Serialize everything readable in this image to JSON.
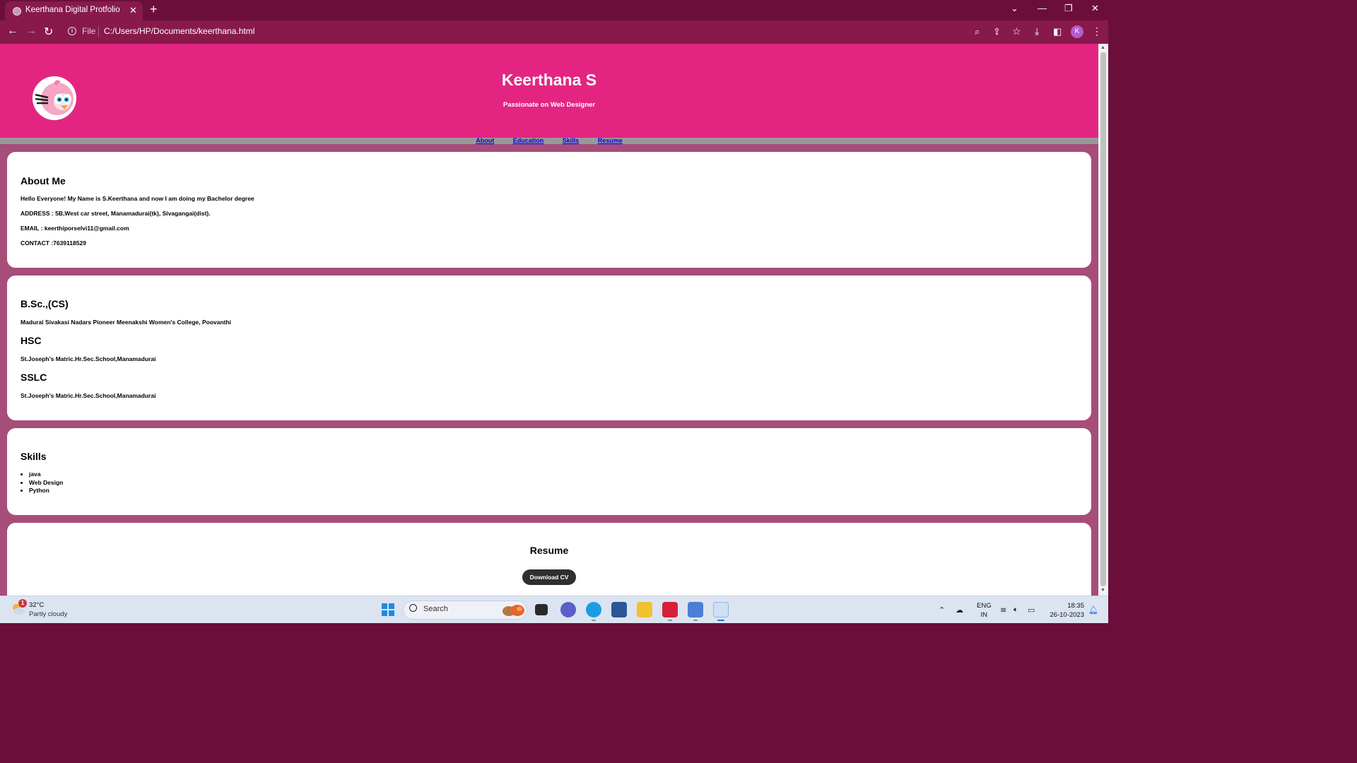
{
  "browser": {
    "tab_title": "Keerthana Digital Protfolio",
    "url_scheme": "File",
    "url": "C:/Users/HP/Documents/keerthana.html",
    "profile_initial": "K"
  },
  "site": {
    "name": "Keerthana S",
    "tagline": "Passionate on Web Designer"
  },
  "nav": {
    "about": "About",
    "education": "Education",
    "skills": "Skills",
    "resume": "Resume"
  },
  "about": {
    "heading": "About Me",
    "intro": "Hello Everyone! My Name is S.Keerthana and now I am doing my Bachelor degree",
    "address": "ADDRESS : 5B,West car street, Manamadurai(tk), Sivagangai(dist).",
    "email": "EMAIL : keerthiporselvi11@gmail.com",
    "contact": "CONTACT :7639118529"
  },
  "education": {
    "degree": "B.Sc.,(CS)",
    "degree_school": "Madurai Sivakasi Nadars Pioneer Meenakshi Women's College, Poovanthi",
    "hsc": "HSC",
    "hsc_school": "St.Joseph's Matric.Hr.Sec.School,Manamadurai",
    "sslc": "SSLC",
    "sslc_school": "St.Joseph's Matric.Hr.Sec.School,Manamadurai"
  },
  "skills": {
    "heading": "Skills",
    "items": [
      "java",
      "Web Design",
      "Python"
    ]
  },
  "resume": {
    "heading": "Resume",
    "button": "Download CV"
  },
  "taskbar": {
    "weather_badge": "1",
    "temperature": "32°C",
    "weather": "Partly cloudy",
    "search_placeholder": "Search",
    "lang_line1": "ENG",
    "lang_line2": "IN",
    "time": "18:35",
    "date": "26-10-2023"
  },
  "colors": {
    "header": "#e32581",
    "page_bg": "#a64d79",
    "browser_frame": "#6b0f3a",
    "browser_toolbar": "#871a4a"
  }
}
